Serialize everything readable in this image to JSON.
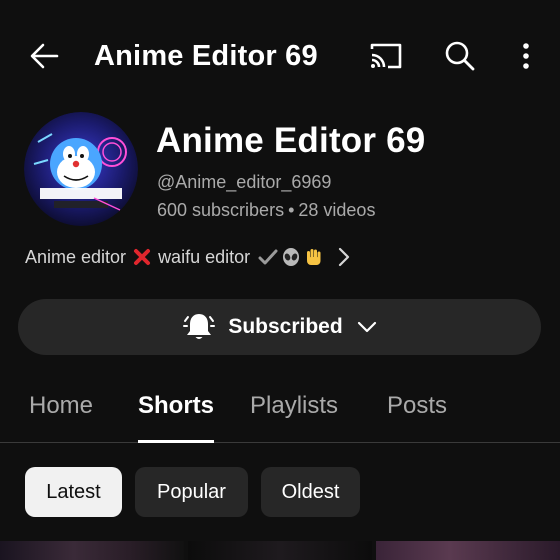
{
  "header": {
    "title": "Anime Editor 69",
    "back_icon": "arrow-left-icon",
    "cast_icon": "cast-icon",
    "search_icon": "search-icon",
    "more_icon": "more-vertical-icon"
  },
  "channel": {
    "name": "Anime Editor 69",
    "handle": "@Anime_editor_6969",
    "subscribers": "600 subscribers",
    "separator": "•",
    "videos": "28 videos",
    "avatar_text": "ANIME EDITOR",
    "description": "Anime editor",
    "description_2": "waifu editor",
    "description_emojis": [
      "cross-mark-icon",
      "check-mark-icon",
      "alien-icon",
      "raised-hand-icon"
    ]
  },
  "subscribe": {
    "label": "Subscribed",
    "bell_icon": "bell-icon",
    "chevron_icon": "chevron-down-icon"
  },
  "tabs": [
    {
      "label": "Home",
      "active": false
    },
    {
      "label": "Shorts",
      "active": true
    },
    {
      "label": "Playlists",
      "active": false
    },
    {
      "label": "Posts",
      "active": false
    }
  ],
  "filters": [
    {
      "label": "Latest",
      "active": true
    },
    {
      "label": "Popular",
      "active": false
    },
    {
      "label": "Oldest",
      "active": false
    }
  ],
  "colors": {
    "background": "#0f0f0f",
    "surface": "#272727",
    "text_secondary": "#aaaaaa",
    "active_chip": "#f1f1f1"
  }
}
